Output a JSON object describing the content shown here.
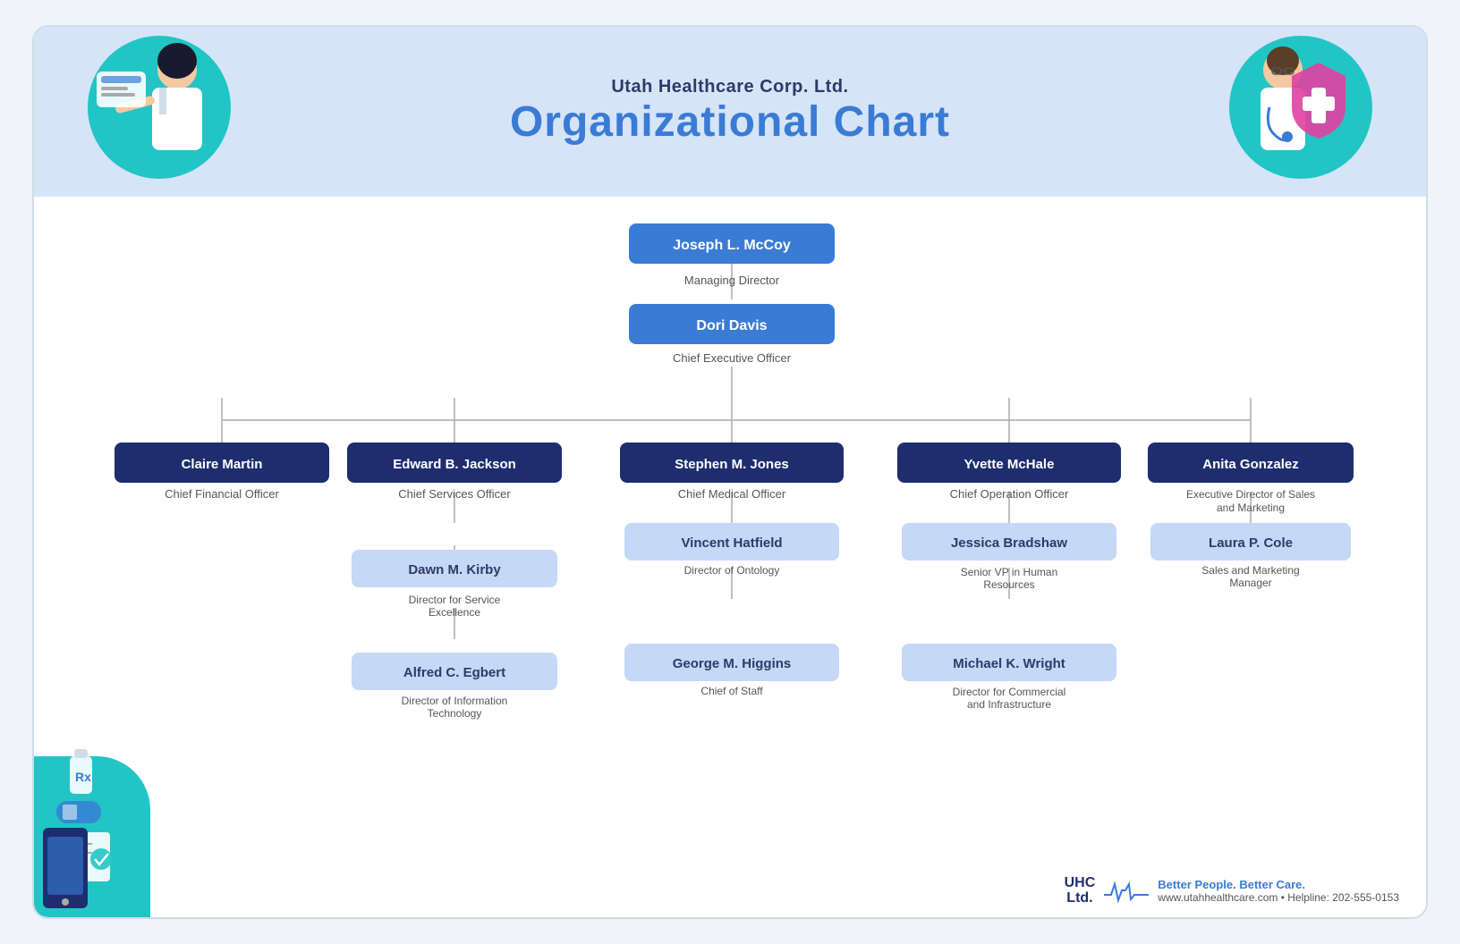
{
  "header": {
    "subtitle": "Utah Healthcare Corp. Ltd.",
    "title": "Organizational Chart"
  },
  "nodes": {
    "level0": {
      "name": "Joseph L. McCoy",
      "title": "Managing Director"
    },
    "level1": {
      "name": "Dori Davis",
      "title": "Chief Executive Officer"
    },
    "level2": [
      {
        "name": "Claire Martin",
        "title": "Chief Financial Officer",
        "children": []
      },
      {
        "name": "Edward B. Jackson",
        "title": "Chief Services Officer",
        "children": [
          {
            "name": "Dawn M. Kirby",
            "title": "Director for Service Excellence"
          },
          {
            "name": "Alfred C. Egbert",
            "title": "Director of Information Technology"
          }
        ]
      },
      {
        "name": "Stephen M. Jones",
        "title": "Chief Medical Officer",
        "children": [
          {
            "name": "Vincent Hatfield",
            "title": "Director of Ontology"
          },
          {
            "name": "George M. Higgins",
            "title": "Chief of Staff"
          }
        ]
      },
      {
        "name": "Yvette McHale",
        "title": "Chief Operation Officer",
        "children": [
          {
            "name": "Jessica Bradshaw",
            "title": "Senior VP in Human Resources"
          },
          {
            "name": "Michael K. Wright",
            "title": "Director for Commercial and Infrastructure"
          }
        ]
      },
      {
        "name": "Anita Gonzalez",
        "title": "Executive Director of Sales and Marketing",
        "children": [
          {
            "name": "Laura P. Cole",
            "title": "Sales and Marketing Manager"
          }
        ]
      }
    ]
  },
  "footer": {
    "logo": "UHC\nLtd.",
    "tagline": "Better People. Better Care.",
    "url": "www.utahhealthcare.com • Helpline: 202-555-0153"
  }
}
